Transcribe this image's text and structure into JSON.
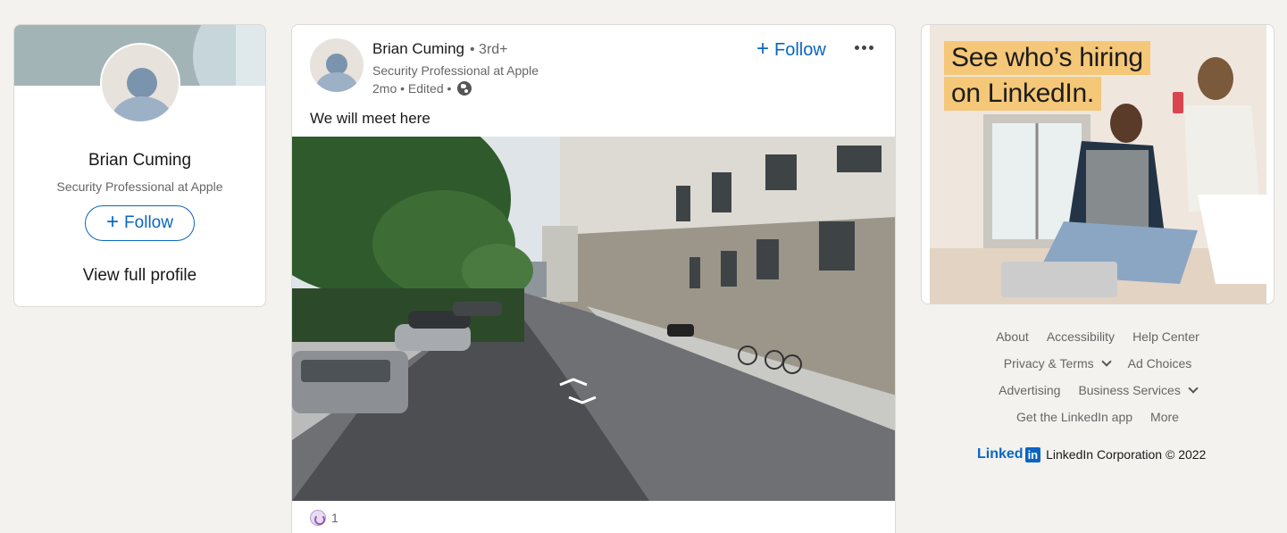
{
  "profile_card": {
    "name": "Brian Cuming",
    "headline": "Security Professional at Apple",
    "follow_label": "Follow",
    "view_profile_label": "View full profile"
  },
  "post": {
    "author_name": "Brian Cuming",
    "degree": "• 3rd+",
    "author_headline": "Security Professional at Apple",
    "time": "2mo • Edited •",
    "follow_label": "Follow",
    "text": "We will meet here",
    "reaction_count": "1"
  },
  "ad": {
    "line1": "See who’s hiring",
    "line2": "on LinkedIn."
  },
  "footer": {
    "row1": [
      "About",
      "Accessibility",
      "Help Center"
    ],
    "row2": [
      "Privacy & Terms",
      "Ad Choices"
    ],
    "row3": [
      "Advertising",
      "Business Services"
    ],
    "row4": [
      "Get the LinkedIn app",
      "More"
    ],
    "brand_logo_text": "Linked",
    "brand_logo_box": "in",
    "copyright": "LinkedIn Corporation © 2022"
  },
  "colors": {
    "accent": "#0a66c2",
    "page_bg": "#f3f2ef",
    "ad_highlight": "#f5c778"
  },
  "icons": [
    "plus-icon",
    "more-icon",
    "globe-icon",
    "reaction-icon",
    "chevron-down-icon"
  ]
}
